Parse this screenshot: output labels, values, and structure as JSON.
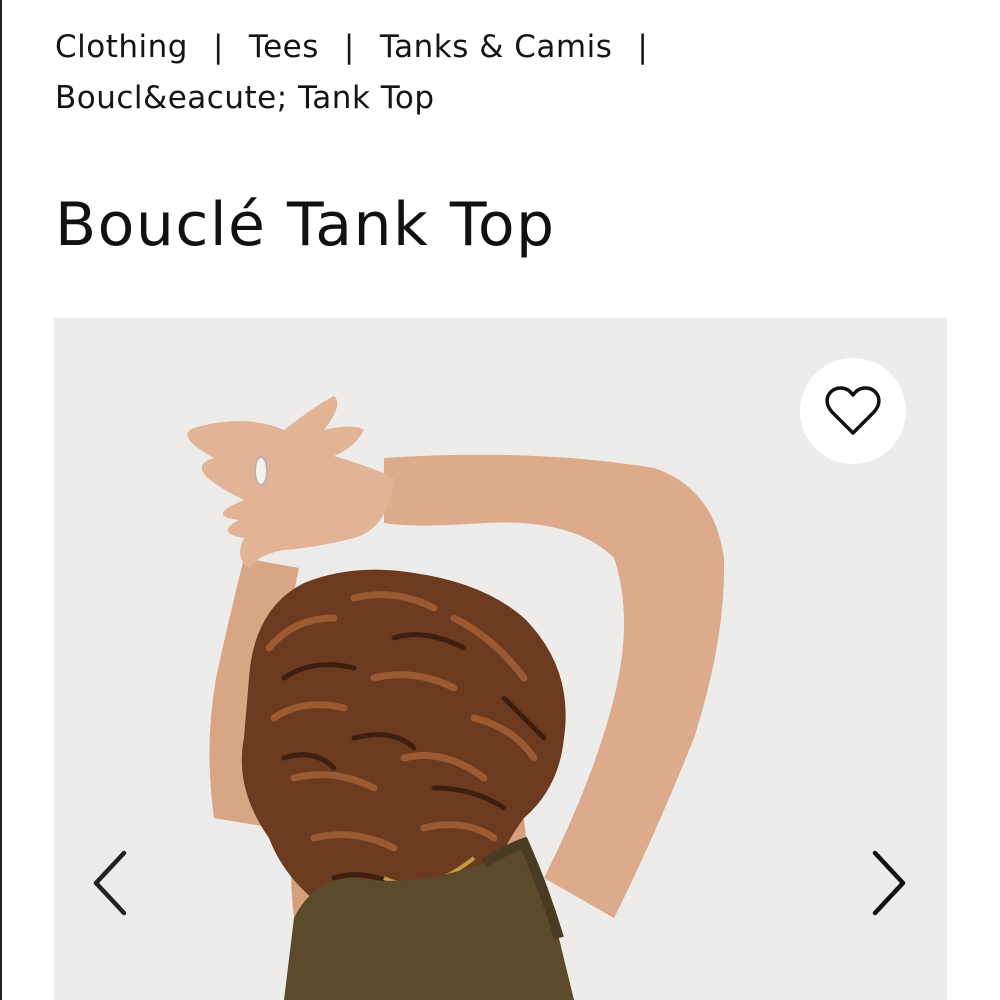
{
  "breadcrumb": {
    "items": [
      "Clothing",
      "Tees",
      "Tanks & Camis",
      "Boucl&eacute; Tank Top"
    ],
    "separator": "|"
  },
  "product": {
    "title": "Bouclé Tank Top"
  },
  "gallery": {
    "favorite_icon": "heart-outline-icon",
    "prev_icon": "chevron-left-icon",
    "next_icon": "chevron-right-icon",
    "background_color": "#eeecea"
  }
}
